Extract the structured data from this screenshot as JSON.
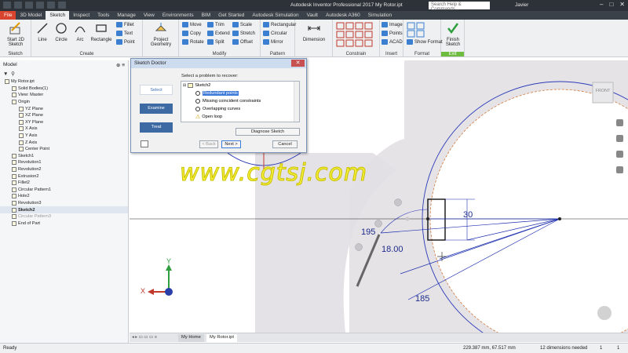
{
  "titlebar": {
    "title": "Autodesk Inventor Professional 2017    My Rotor.ipt",
    "search_placeholder": "Search Help & Commands...",
    "user": "Javier"
  },
  "tabs": [
    "File",
    "3D Model",
    "Sketch",
    "Inspect",
    "Tools",
    "Manage",
    "View",
    "Environments",
    "BIM",
    "Get Started",
    "Autodesk Simulation",
    "Vault",
    "Autodesk A360",
    "Simulation"
  ],
  "ribbon": {
    "sketch_group": {
      "start_label": "Start 2D Sketch",
      "group_label": "Sketch"
    },
    "create_group": {
      "line": "Line",
      "circle": "Circle",
      "arc": "Arc",
      "rectangle": "Rectangle",
      "fillet": "Fillet",
      "text": "Text",
      "point": "Point",
      "group_label": "Create"
    },
    "geometry": {
      "label": "Project Geometry"
    },
    "modify_group": {
      "move": "Move",
      "copy": "Copy",
      "rotate": "Rotate",
      "trim": "Trim",
      "extend": "Extend",
      "split": "Split",
      "scale": "Scale",
      "stretch": "Stretch",
      "offset": "Offset",
      "group_label": "Modify"
    },
    "pattern_group": {
      "rectangular": "Rectangular",
      "circular": "Circular",
      "mirror": "Mirror",
      "group_label": "Pattern"
    },
    "dimension": {
      "label": "Dimension"
    },
    "constrain_group": {
      "group_label": "Constrain"
    },
    "insert_group": {
      "image": "Image",
      "points": "Points",
      "acad": "ACAD",
      "group_label": "Insert"
    },
    "format_group": {
      "show_format": "Show Format",
      "group_label": "Format"
    },
    "exit_group": {
      "finish": "Finish Sketch",
      "group_label": "Exit"
    }
  },
  "browser": {
    "title": "Model",
    "items": [
      {
        "label": "My Rotor.ipt",
        "indent": 0
      },
      {
        "label": "Solid Bodies(1)",
        "indent": 1
      },
      {
        "label": "View: Master",
        "indent": 1
      },
      {
        "label": "Origin",
        "indent": 1
      },
      {
        "label": "YZ Plane",
        "indent": 2
      },
      {
        "label": "XZ Plane",
        "indent": 2
      },
      {
        "label": "XY Plane",
        "indent": 2
      },
      {
        "label": "X Axis",
        "indent": 2
      },
      {
        "label": "Y Axis",
        "indent": 2
      },
      {
        "label": "Z Axis",
        "indent": 2
      },
      {
        "label": "Center Point",
        "indent": 2
      },
      {
        "label": "Sketch1",
        "indent": 1
      },
      {
        "label": "Revolution1",
        "indent": 1
      },
      {
        "label": "Revolution2",
        "indent": 1
      },
      {
        "label": "Extrusion2",
        "indent": 1
      },
      {
        "label": "Fillet2",
        "indent": 1
      },
      {
        "label": "Circular Pattern1",
        "indent": 1
      },
      {
        "label": "Hole2",
        "indent": 1
      },
      {
        "label": "Revolution3",
        "indent": 1
      },
      {
        "label": "Sketch2",
        "indent": 1,
        "selected": true
      },
      {
        "label": "Circular Pattern3",
        "indent": 1,
        "dim": true
      },
      {
        "label": "End of Part",
        "indent": 1
      }
    ]
  },
  "dialog": {
    "title": "Sketch Doctor",
    "nav": [
      "Select",
      "Examine",
      "Treat"
    ],
    "prompt": "Select a problem to recover:",
    "tree_root": "Sketch2",
    "problems": [
      "Redundant points",
      "Missing coincident constraints",
      "Overlapping curves",
      "Open loop"
    ],
    "diagnose_button": "Diagnose Sketch",
    "back_button": "< Back",
    "next_button": "Next >",
    "cancel_button": "Cancel"
  },
  "viewport": {
    "watermark": "www.cgtsj.com",
    "viewcube_label": "FRONT",
    "dimensions": [
      "30",
      "195",
      "18.00",
      "185"
    ],
    "axis_x": "X",
    "axis_y": "Y"
  },
  "doc_tabs": [
    "My Home",
    "My Rotor.ipt"
  ],
  "status": {
    "left": "Ready",
    "coords": "229.387 mm, 67.517 mm",
    "dims_needed": "12 dimensions needed",
    "page": "1",
    "count": "1"
  },
  "colors": {
    "title_bg": "#2d3238",
    "file_tab": "#d8442e",
    "watermark": "#f5ef3a",
    "sketch_blue": "#1d2fae",
    "dim_text": "#1c2a8a"
  }
}
